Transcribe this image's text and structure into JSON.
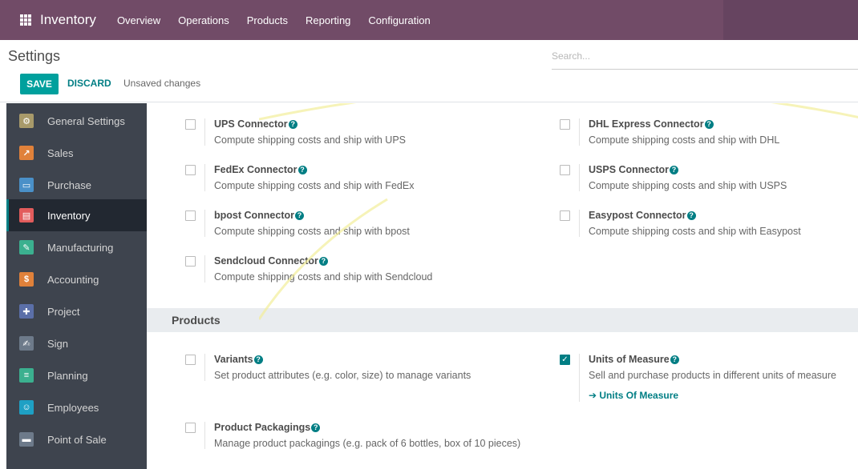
{
  "navbar": {
    "app_name": "Inventory",
    "menus": [
      "Overview",
      "Operations",
      "Products",
      "Reporting",
      "Configuration"
    ]
  },
  "control_panel": {
    "title": "Settings",
    "search_placeholder": "Search...",
    "save_label": "SAVE",
    "discard_label": "DISCARD",
    "status": "Unsaved changes"
  },
  "sidebar": {
    "items": [
      {
        "label": "General Settings",
        "icon": "gear-icon",
        "color": "#a89a6a"
      },
      {
        "label": "Sales",
        "icon": "chart-icon",
        "color": "#e0813a"
      },
      {
        "label": "Purchase",
        "icon": "cart-icon",
        "color": "#4a90c8"
      },
      {
        "label": "Inventory",
        "icon": "box-icon",
        "color": "#e25c5c"
      },
      {
        "label": "Manufacturing",
        "icon": "wrench-icon",
        "color": "#3bb08f"
      },
      {
        "label": "Accounting",
        "icon": "invoice-icon",
        "color": "#e0813a"
      },
      {
        "label": "Project",
        "icon": "puzzle-icon",
        "color": "#5b6fa8"
      },
      {
        "label": "Sign",
        "icon": "sign-icon",
        "color": "#6d7a8a"
      },
      {
        "label": "Planning",
        "icon": "planning-icon",
        "color": "#3bb08f"
      },
      {
        "label": "Employees",
        "icon": "people-icon",
        "color": "#1ea0c4"
      },
      {
        "label": "Point of Sale",
        "icon": "store-icon",
        "color": "#6d7a8a"
      }
    ]
  },
  "shipping": [
    {
      "label": "UPS Connector",
      "desc": "Compute shipping costs and ship with UPS",
      "checked": false
    },
    {
      "label": "DHL Express Connector",
      "desc": "Compute shipping costs and ship with DHL",
      "checked": false
    },
    {
      "label": "FedEx Connector",
      "desc": "Compute shipping costs and ship with FedEx",
      "checked": false
    },
    {
      "label": "USPS Connector",
      "desc": "Compute shipping costs and ship with USPS",
      "checked": false
    },
    {
      "label": "bpost Connector",
      "desc": "Compute shipping costs and ship with bpost",
      "checked": false
    },
    {
      "label": "Easypost Connector",
      "desc": "Compute shipping costs and ship with Easypost",
      "checked": false
    },
    {
      "label": "Sendcloud Connector",
      "desc": "Compute shipping costs and ship with Sendcloud",
      "checked": false
    }
  ],
  "products_section": {
    "title": "Products",
    "settings": [
      {
        "label": "Variants",
        "desc": "Set product attributes (e.g. color, size) to manage variants",
        "checked": false
      },
      {
        "label": "Units of Measure",
        "desc": "Sell and purchase products in different units of measure",
        "checked": true,
        "link": "Units Of Measure"
      },
      {
        "label": "Product Packagings",
        "desc": "Manage product packagings (e.g. pack of 6 bottles, box of 10 pieces)",
        "checked": false
      }
    ]
  },
  "watermark": {
    "text": "GIJAPRANA",
    "color": "#f2ee9a"
  }
}
